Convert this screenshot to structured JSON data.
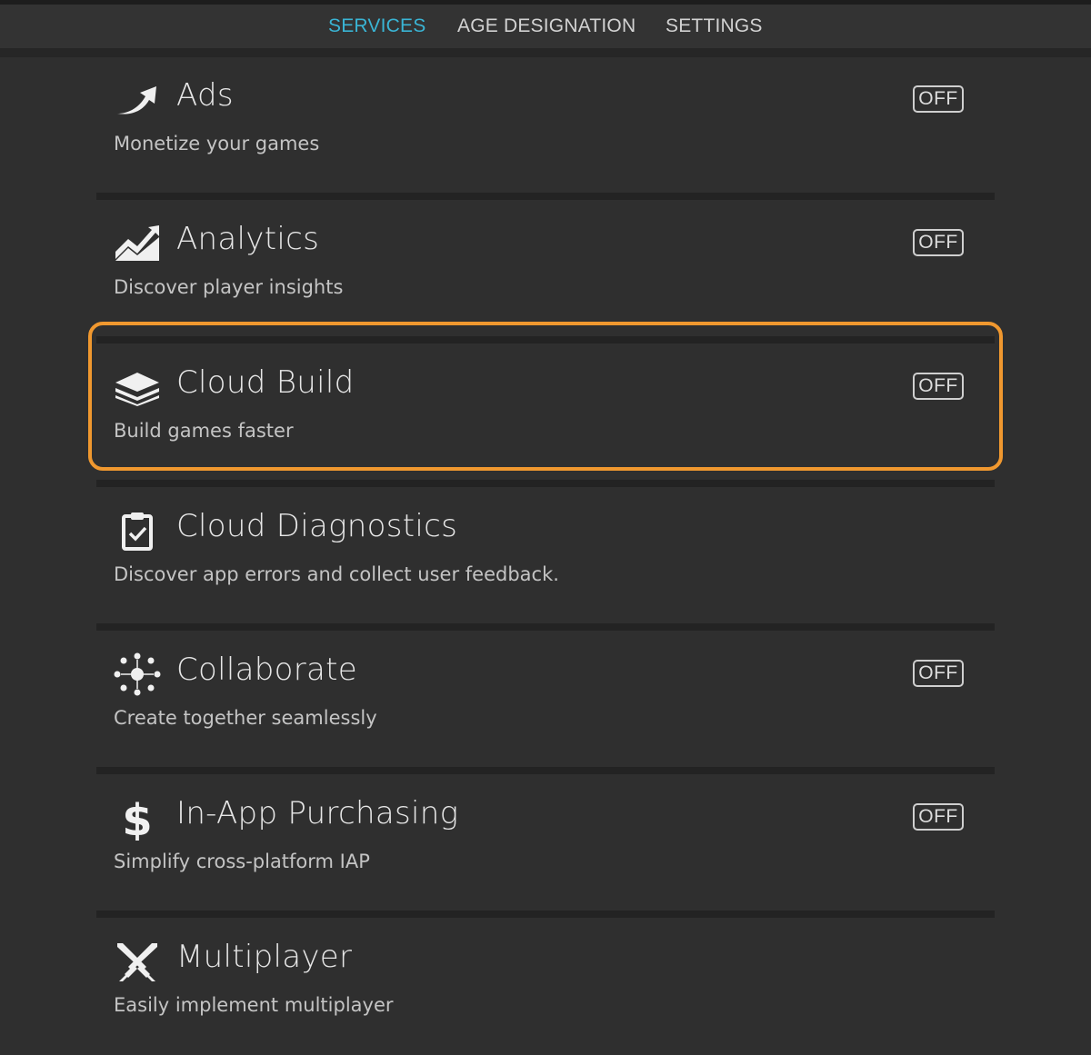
{
  "tabs": [
    {
      "label": "SERVICES",
      "active": true
    },
    {
      "label": "AGE DESIGNATION",
      "active": false
    },
    {
      "label": "SETTINGS",
      "active": false
    }
  ],
  "colors": {
    "accent_tab": "#3ab4d4",
    "highlight": "#f0982f",
    "background": "#2f2f2f"
  },
  "services": [
    {
      "title": "Ads",
      "description": "Monetize your games",
      "toggle": "OFF",
      "icon": "curved-arrow-icon"
    },
    {
      "title": "Analytics",
      "description": "Discover player insights",
      "toggle": "OFF",
      "icon": "trend-chart-icon"
    },
    {
      "title": "Cloud Build",
      "description": "Build games faster",
      "toggle": "OFF",
      "icon": "layers-stack-icon"
    },
    {
      "title": "Cloud Diagnostics",
      "description": "Discover app errors and collect user feedback.",
      "toggle": "",
      "icon": "clipboard-check-icon"
    },
    {
      "title": "Collaborate",
      "description": "Create together seamlessly",
      "toggle": "OFF",
      "icon": "network-nodes-icon"
    },
    {
      "title": "In-App Purchasing",
      "description": "Simplify cross-platform IAP",
      "toggle": "OFF",
      "icon": "dollar-sign-icon"
    },
    {
      "title": "Multiplayer",
      "description": "Easily implement multiplayer",
      "toggle": "",
      "icon": "crossed-swords-icon"
    }
  ]
}
